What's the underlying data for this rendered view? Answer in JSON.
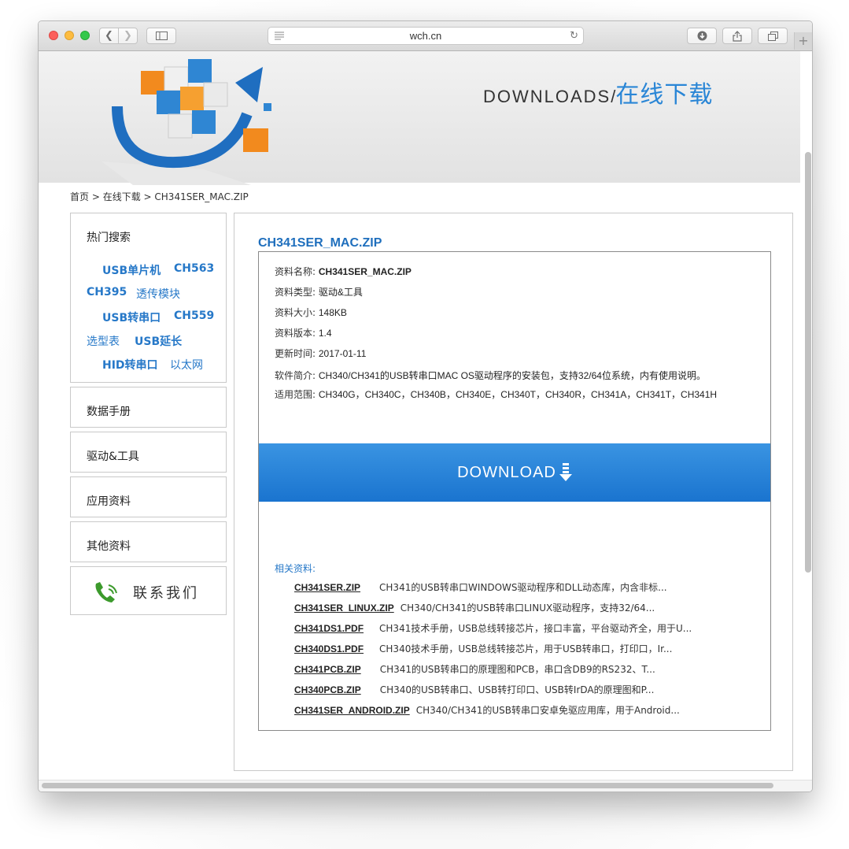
{
  "browser": {
    "url": "wch.cn"
  },
  "banner": {
    "title_en": "DOWNLOADS",
    "slash": "/",
    "title_cn": "在线下载"
  },
  "breadcrumb": {
    "home": "首页",
    "sep1": " > ",
    "section": "在线下载",
    "sep2": " > ",
    "current": "CH341SER_MAC.ZIP"
  },
  "sidebar": {
    "hot_title": "热门搜索",
    "hot_links": [
      "USB单片机",
      "CH563",
      "CH395",
      "透传模块",
      "USB转串口",
      "CH559",
      "选型表",
      "USB延长",
      "HID转串口",
      "以太网"
    ],
    "menu": [
      "数据手册",
      "驱动&工具",
      "应用资料",
      "其他资料"
    ],
    "contact": "联系我们"
  },
  "main": {
    "title": "CH341SER_MAC.ZIP",
    "info": [
      {
        "label": "资料名称:",
        "value": "CH341SER_MAC.ZIP"
      },
      {
        "label": "资料类型:",
        "value": "驱动&工具"
      },
      {
        "label": "资料大小:",
        "value": "148KB"
      },
      {
        "label": "资料版本:",
        "value": "1.4"
      },
      {
        "label": "更新时间:",
        "value": "2017-01-11"
      },
      {
        "label": "软件简介:",
        "value": "CH340/CH341的USB转串口MAC OS驱动程序的安装包，支持32/64位系统，内有使用说明。"
      },
      {
        "label": "适用范围:",
        "value": "CH340G，CH340C，CH340B，CH340E，CH340T，CH340R，CH341A，CH341T，CH341H"
      }
    ],
    "download_label": "DOWNLOAD",
    "related_title": "相关资料:",
    "related": [
      {
        "name": "CH341SER.ZIP",
        "desc": "CH341的USB转串口WINDOWS驱动程序和DLL动态库，内含非标..."
      },
      {
        "name": "CH341SER_LINUX.ZIP",
        "desc": "CH340/CH341的USB转串口LINUX驱动程序，支持32/64..."
      },
      {
        "name": "CH341DS1.PDF",
        "desc": "CH341技术手册，USB总线转接芯片，接口丰富，平台驱动齐全，用于U..."
      },
      {
        "name": "CH340DS1.PDF",
        "desc": "CH340技术手册，USB总线转接芯片，用于USB转串口，打印口，Ir..."
      },
      {
        "name": "CH341PCB.ZIP",
        "desc": "CH341的USB转串口的原理图和PCB，串口含DB9的RS232、T..."
      },
      {
        "name": "CH340PCB.ZIP",
        "desc": "CH340的USB转串口、USB转打印口、USB转IrDA的原理图和P..."
      },
      {
        "name": "CH341SER_ANDROID.ZIP",
        "desc": "CH340/CH341的USB转串口安卓免驱应用库，用于Android..."
      }
    ]
  },
  "colors": {
    "link_blue": "#2678c8",
    "title_blue": "#1f6fbd",
    "download_bg": "#2a84d9"
  }
}
